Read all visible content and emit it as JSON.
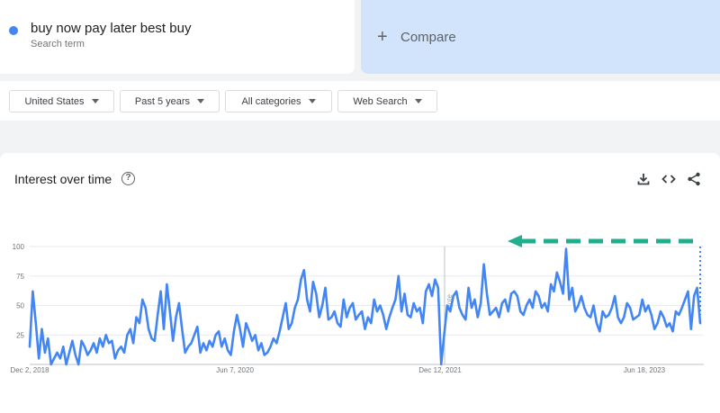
{
  "search_term": {
    "label": "buy now pay later best buy",
    "sub": "Search term",
    "color": "#4285f4"
  },
  "compare": {
    "label": "Compare",
    "plus": "+"
  },
  "filters": [
    {
      "label": "United States"
    },
    {
      "label": "Past 5 years"
    },
    {
      "label": "All categories"
    },
    {
      "label": "Web Search"
    }
  ],
  "chart_header": {
    "title": "Interest over time",
    "help": "?"
  },
  "icons": [
    "download-icon",
    "embed-code-icon",
    "share-icon"
  ],
  "chart_data": {
    "type": "line",
    "title": "Interest over time",
    "xlabel": "",
    "ylabel": "",
    "ylim": [
      0,
      100
    ],
    "yticks": [
      25,
      50,
      75,
      100
    ],
    "x_tick_labels": [
      "Dec 2, 2018",
      "Jun 7, 2020",
      "Dec 12, 2021",
      "Jun 18, 2023"
    ],
    "annotation": "Note",
    "grid": true,
    "line_color": "#4285f4",
    "series": [
      {
        "values": [
          15,
          62,
          35,
          5,
          30,
          10,
          22,
          0,
          5,
          10,
          5,
          15,
          0,
          10,
          20,
          8,
          0,
          20,
          15,
          8,
          12,
          18,
          10,
          22,
          15,
          25,
          18,
          20,
          5,
          12,
          15,
          10,
          25,
          30,
          18,
          40,
          35,
          55,
          48,
          30,
          22,
          20,
          42,
          62,
          30,
          68,
          45,
          20,
          40,
          52,
          30,
          10,
          15,
          18,
          25,
          32,
          10,
          18,
          12,
          20,
          15,
          25,
          28,
          15,
          22,
          12,
          8,
          28,
          42,
          30,
          15,
          35,
          28,
          20,
          25,
          12,
          18,
          8,
          10,
          15,
          22,
          18,
          28,
          40,
          52,
          30,
          35,
          48,
          55,
          72,
          80,
          55,
          45,
          70,
          60,
          40,
          50,
          65,
          38,
          40,
          45,
          35,
          32,
          55,
          40,
          48,
          52,
          38,
          42,
          45,
          30,
          40,
          35,
          55,
          45,
          50,
          42,
          30,
          40,
          48,
          55,
          75,
          45,
          60,
          42,
          40,
          52,
          45,
          48,
          35,
          62,
          68,
          58,
          72,
          65,
          0,
          25,
          50,
          45,
          58,
          62,
          48,
          42,
          38,
          65,
          48,
          55,
          40,
          52,
          85,
          60,
          42,
          45,
          48,
          40,
          52,
          55,
          45,
          60,
          62,
          58,
          45,
          42,
          50,
          55,
          48,
          62,
          58,
          48,
          52,
          45,
          68,
          62,
          78,
          70,
          60,
          98,
          55,
          65,
          45,
          50,
          58,
          48,
          42,
          40,
          50,
          35,
          28,
          45,
          40,
          42,
          48,
          58,
          40,
          35,
          40,
          52,
          48,
          38,
          40,
          42,
          55,
          45,
          50,
          42,
          30,
          35,
          45,
          40,
          32,
          35,
          28,
          45,
          42,
          48,
          55,
          62,
          30,
          58,
          65,
          35
        ]
      }
    ]
  }
}
